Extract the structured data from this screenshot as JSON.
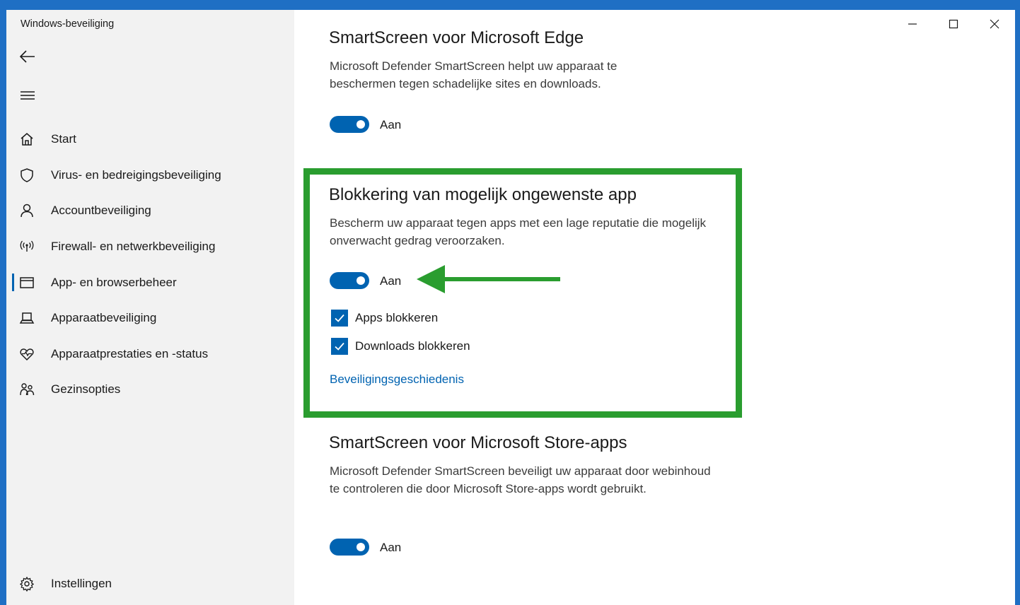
{
  "window": {
    "title": "Windows-beveiliging"
  },
  "sidebar": {
    "items": [
      {
        "label": "Start",
        "icon": "home-icon"
      },
      {
        "label": "Virus- en bedreigingsbeveiliging",
        "icon": "shield-icon"
      },
      {
        "label": "Accountbeveiliging",
        "icon": "person-icon"
      },
      {
        "label": "Firewall- en netwerkbeveiliging",
        "icon": "wifi-antenna-icon"
      },
      {
        "label": "App- en browserbeheer",
        "icon": "browser-window-icon",
        "selected": true
      },
      {
        "label": "Apparaatbeveiliging",
        "icon": "laptop-icon"
      },
      {
        "label": "Apparaatprestaties en -status",
        "icon": "heart-pulse-icon"
      },
      {
        "label": "Gezinsopties",
        "icon": "family-icon"
      }
    ],
    "settings_label": "Instellingen"
  },
  "main": {
    "edge": {
      "title": "SmartScreen voor Microsoft Edge",
      "description": "Microsoft Defender SmartScreen helpt uw apparaat te beschermen tegen schadelijke sites en downloads.",
      "toggle_label": "Aan"
    },
    "pua": {
      "title": "Blokkering van mogelijk ongewenste app",
      "description": "Bescherm uw apparaat tegen apps met een lage reputatie die mogelijk onverwacht gedrag veroorzaken.",
      "toggle_label": "Aan",
      "check_apps": "Apps blokkeren",
      "check_downloads": "Downloads blokkeren",
      "history_link": "Beveiligingsgeschiedenis"
    },
    "store": {
      "title": "SmartScreen voor Microsoft Store-apps",
      "description": "Microsoft Defender SmartScreen beveiligt uw apparaat door webinhoud te controleren die door Microsoft Store-apps wordt gebruikt.",
      "toggle_label": "Aan"
    }
  },
  "colors": {
    "accent": "#0063b1",
    "highlight": "#2a9d2f",
    "frame": "#1f6fc4"
  }
}
